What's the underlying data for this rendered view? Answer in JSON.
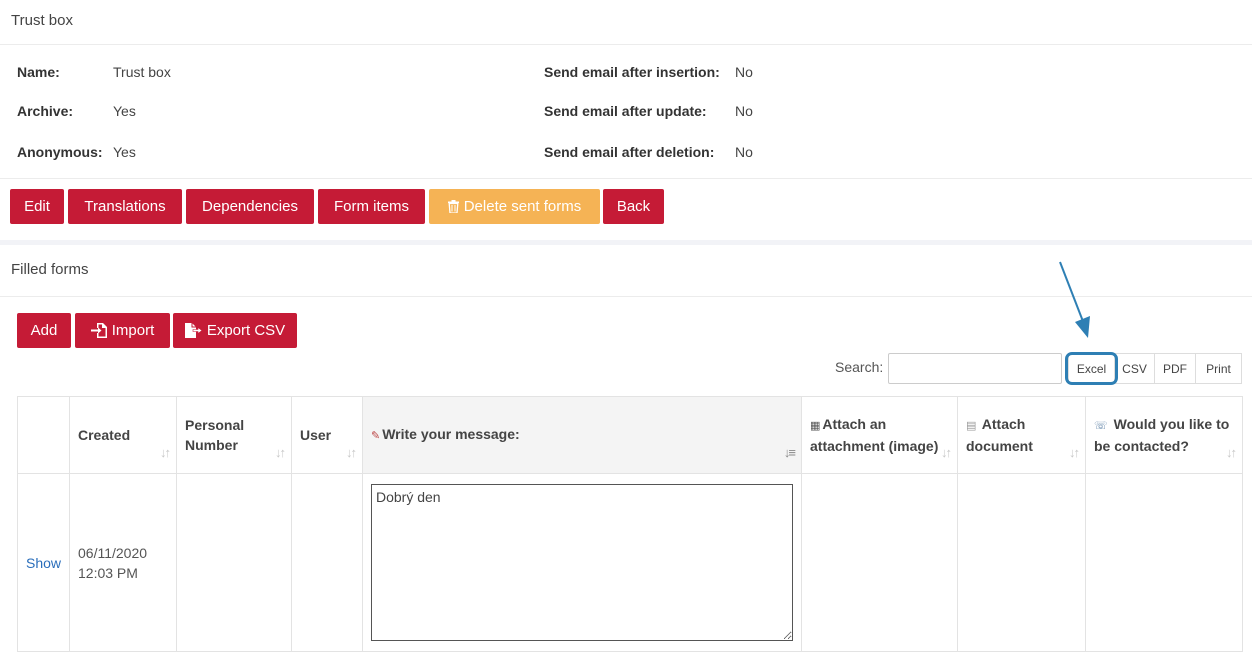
{
  "header": {
    "title": "Trust box"
  },
  "info": {
    "name_label": "Name:",
    "name_value": "Trust box",
    "archive_label": "Archive:",
    "archive_value": "Yes",
    "anonymous_label": "Anonymous:",
    "anonymous_value": "Yes",
    "email_insert_label": "Send email after insertion:",
    "email_insert_value": "No",
    "email_update_label": "Send email after update:",
    "email_update_value": "No",
    "email_delete_label": "Send email after deletion:",
    "email_delete_value": "No"
  },
  "actions": {
    "edit": "Edit",
    "translations": "Translations",
    "dependencies": "Dependencies",
    "form_items": "Form items",
    "delete_sent_forms": "Delete sent forms",
    "back": "Back"
  },
  "filled_forms": {
    "title": "Filled forms",
    "add": "Add",
    "import": "Import",
    "export_csv": "Export CSV",
    "search_label": "Search:",
    "search_value": "",
    "export_buttons": {
      "excel": "Excel",
      "csv": "CSV",
      "pdf": "PDF",
      "print": "Print"
    }
  },
  "table": {
    "headers": {
      "created": "Created",
      "personal_number": "Personal Number",
      "user": "User",
      "message": "Write your message:",
      "attach_image": "Attach an attachment (image)",
      "attach_document": "Attach document",
      "contact": "Would you like to be contacted?"
    },
    "rows": [
      {
        "action": "Show",
        "created_date": "06/11/2020",
        "created_time": "12:03 PM",
        "personal_number": "",
        "user": "",
        "message": "Dobrý den",
        "attach_image": "",
        "attach_document": "",
        "contact": ""
      }
    ]
  },
  "colors": {
    "primary": "#c51b36",
    "warning": "#f5b355",
    "highlight": "#2e7fb4",
    "link": "#2a6ebb"
  }
}
